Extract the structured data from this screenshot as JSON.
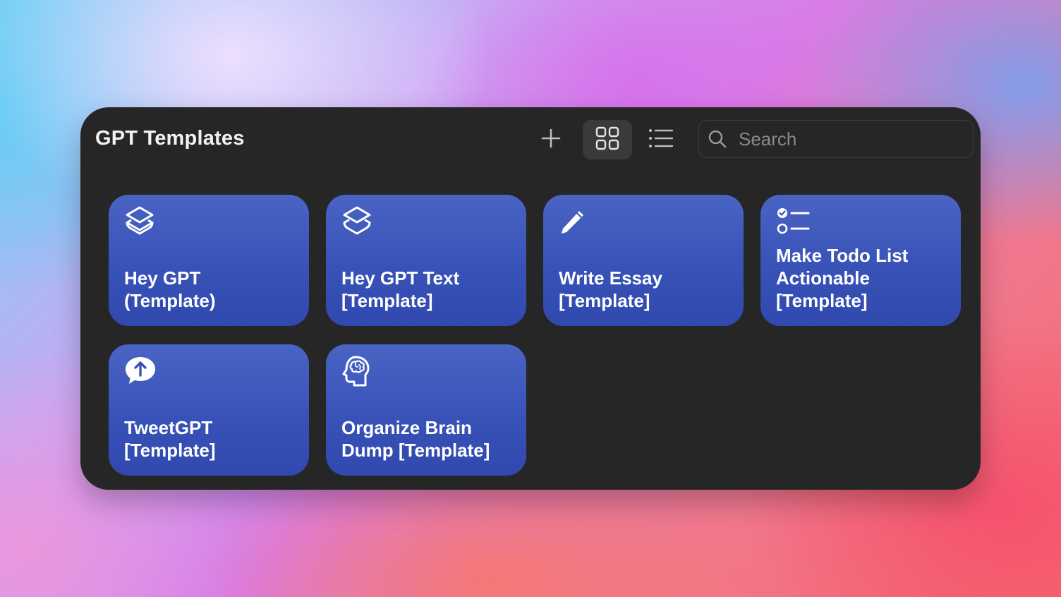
{
  "window": {
    "title": "GPT Templates"
  },
  "toolbar": {
    "add_icon": "plus-icon",
    "grid_icon": "grid-view-icon",
    "list_icon": "list-view-icon",
    "active_view": "grid"
  },
  "search": {
    "placeholder": "Search",
    "value": "",
    "icon": "search-icon"
  },
  "cards": [
    {
      "label": "Hey GPT\n(Template)",
      "icon": "layers-icon"
    },
    {
      "label": "Hey GPT Text\n[Template]",
      "icon": "layers-icon"
    },
    {
      "label": "Write Essay\n[Template]",
      "icon": "pencil-icon"
    },
    {
      "label": "Make Todo List\nActionable\n[Template]",
      "icon": "checklist-icon"
    },
    {
      "label": "TweetGPT\n[Template]",
      "icon": "speech-bubble-up-arrow-icon"
    },
    {
      "label": "Organize Brain\nDump [Template]",
      "icon": "head-brain-icon"
    }
  ],
  "colors": {
    "window_bg": "#262626",
    "card_top": "#4a64c4",
    "card_bottom": "#3149ae",
    "active_button_bg": "#3a3a3a"
  }
}
